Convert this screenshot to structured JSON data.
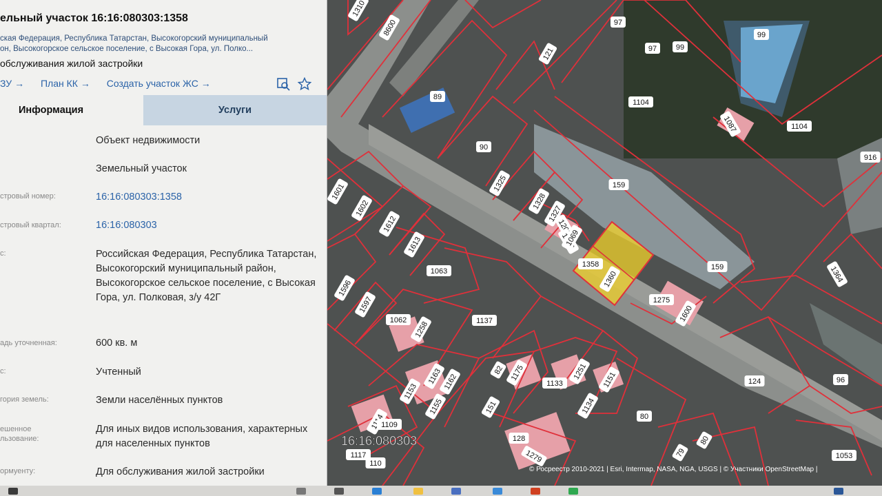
{
  "header": {
    "title": "ельный участок 16:16:080303:1358",
    "address_line1": "ская Федерация, Республика Татарстан, Высокогорский муниципальный",
    "address_line2": "он, Высокогорское сельское поселение, с Высокая Гора, ул. Полко...",
    "use": "обслуживания жилой застройки"
  },
  "links": {
    "zu": "ЗУ →",
    "plan": "План КК →",
    "create": "Создать участок ЖС →"
  },
  "tabs": {
    "info": "Информация",
    "services": "Услуги"
  },
  "rows": [
    {
      "label": "",
      "value": "Объект недвижимости"
    },
    {
      "label": "",
      "value": "Земельный участок"
    },
    {
      "label": "стровый номер:",
      "value": "16:16:080303:1358"
    },
    {
      "label": "стровый квартал:",
      "value": "16:16:080303"
    },
    {
      "label": "с:",
      "value": "Российская Федерация, Республика Татарстан, Высокогорский муниципальный район, Высокогорское сельское поселение, с Высокая Гора, ул. Полковая, з/у 42Г"
    },
    {
      "label": "адь уточненная:",
      "value": "600 кв. м"
    },
    {
      "label": "с:",
      "value": "Учтенный"
    },
    {
      "label": "гория земель:",
      "value": "Земли населённых пунктов"
    },
    {
      "label": "ешенное\nльзование:",
      "value": "Для иных видов использования, характерных для населенных пунктов"
    },
    {
      "label": "ормуенту:",
      "value": "Для обслуживания жилой застройки"
    }
  ],
  "map": {
    "quarter_label": "16:16:080303",
    "attribution": "© Росреестр 2010-2021 | Esri, Intermap, NASA, NGA, USGS | © Участники OpenStreetMap |",
    "parcel_numbers": [
      "1310",
      "8600",
      "97",
      "97",
      "99",
      "99",
      "121",
      "89",
      "1104",
      "1104",
      "1087",
      "90",
      "916",
      "159",
      "159",
      "1325",
      "1328",
      "1327",
      "1208",
      "1326",
      "1069",
      "1358",
      "1360",
      "1275",
      "1600",
      "1364",
      "1601",
      "1602",
      "1612",
      "1613",
      "1063",
      "1596",
      "1597",
      "1062",
      "1258",
      "1137",
      "1153",
      "1163",
      "1162",
      "1155",
      "82",
      "1175",
      "1133",
      "1251",
      "1151",
      "124",
      "96",
      "1114",
      "1109",
      "151",
      "1134",
      "80",
      "128",
      "1279",
      "79",
      "80",
      "1053",
      "1117",
      "110"
    ],
    "colors": {
      "parcel_border": "#e0303a",
      "selected_fill": "#f2d22a",
      "parcel_label": "#111111"
    }
  },
  "taskbar": {
    "icons": [
      "start-icon",
      "search-icon",
      "task-view-icon",
      "edge-icon",
      "explorer-icon",
      "store-icon",
      "mail-icon",
      "office-icon",
      "chrome-icon",
      "word-icon"
    ]
  }
}
